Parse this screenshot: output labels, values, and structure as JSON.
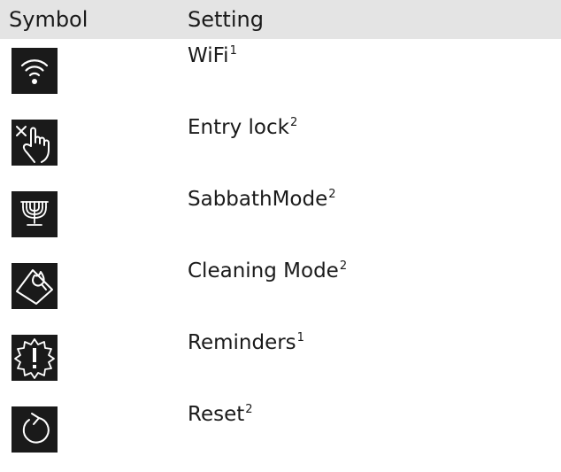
{
  "header": {
    "symbol": "Symbol",
    "setting": "Setting"
  },
  "rows": [
    {
      "icon": "wifi-icon",
      "label": "WiFi",
      "note": "1"
    },
    {
      "icon": "entry-lock-icon",
      "label": "Entry lock",
      "note": "2"
    },
    {
      "icon": "menorah-icon",
      "label": "SabbathMode",
      "note": "2"
    },
    {
      "icon": "cleaning-mode-icon",
      "label": "Cleaning Mode",
      "note": "2"
    },
    {
      "icon": "reminder-gear-icon",
      "label": "Reminders",
      "note": "1"
    },
    {
      "icon": "reset-icon",
      "label": "Reset",
      "note": "2"
    }
  ]
}
